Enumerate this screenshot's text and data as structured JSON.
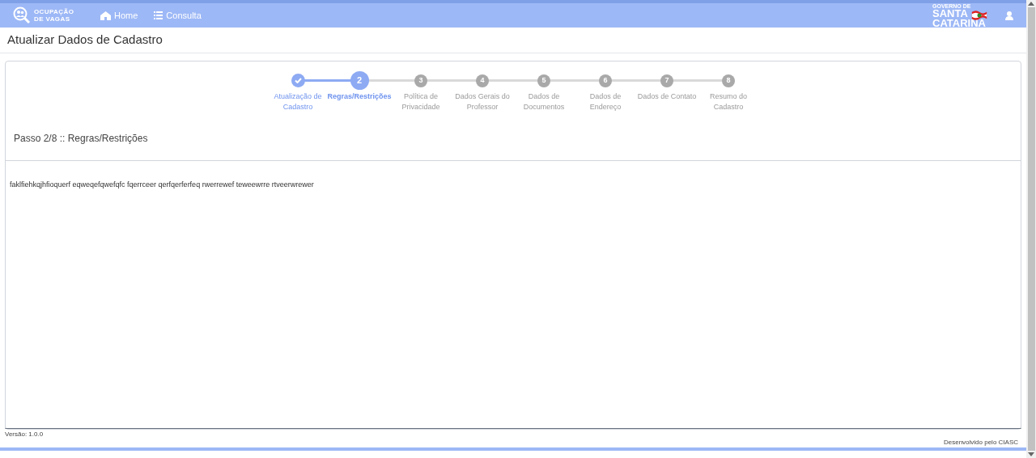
{
  "navbar": {
    "logo_text": [
      "OCUPAÇÃO",
      "DE VAGAS"
    ],
    "links": [
      {
        "kind": "home",
        "label": "Home"
      },
      {
        "kind": "list",
        "label": "Consulta"
      }
    ],
    "brand_text": [
      "GOVERNO DE",
      "SANTA",
      "CATARINA"
    ]
  },
  "page_title": "Atualizar Dados de Cadastro",
  "steps": [
    {
      "label": "Atualização de Cadastro",
      "completed": true,
      "selected": false
    },
    {
      "number": "2",
      "label": "Regras/Restrições",
      "completed": false,
      "selected": true
    },
    {
      "number": "3",
      "label": "Política de Privacidade",
      "completed": false,
      "selected": false
    },
    {
      "number": "4",
      "label": "Dados Gerais do Professor",
      "completed": false,
      "selected": false
    },
    {
      "number": "5",
      "label": "Dados de Documentos",
      "completed": false,
      "selected": false
    },
    {
      "number": "6",
      "label": "Dados de Endereço",
      "completed": false,
      "selected": false
    },
    {
      "number": "7",
      "label": "Dados de Contato",
      "completed": false,
      "selected": false
    },
    {
      "number": "8",
      "label": "Resumo do Cadastro",
      "completed": false,
      "selected": false
    }
  ],
  "step_heading": "Passo 2/8 :: Regras/Restrições",
  "content_text": "faklfiehkqjhfioquerf eqweqefqwefqfc fqerrceer qerfqerferfeq rwerrewef teweewrre rtveerwrewer",
  "version": "Versão: 1.0.0",
  "credit": "Desenvolvido pelo CIASC"
}
